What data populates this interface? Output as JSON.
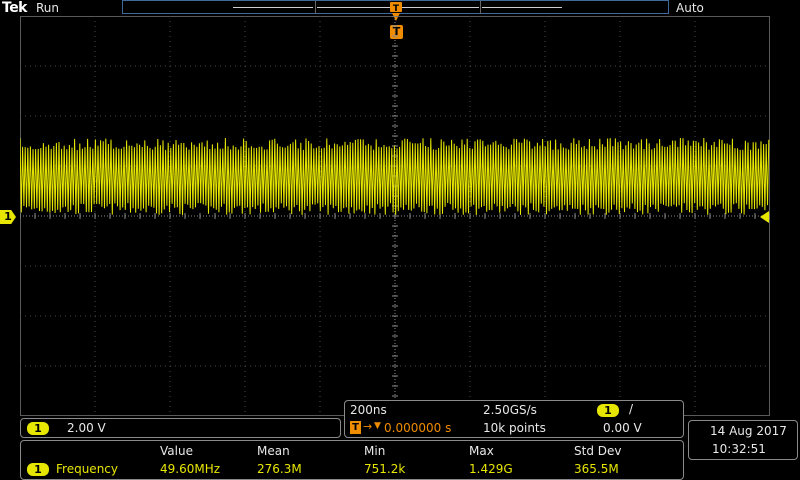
{
  "header": {
    "brand": "Tek",
    "acquisition_state": "Run",
    "trigger_mode": "Auto"
  },
  "trigger_marker_label": "T",
  "channel1": {
    "label": "1",
    "scale": "2.00 V"
  },
  "timebase": {
    "horizontal_scale": "200ns",
    "sample_rate": "2.50GS/s",
    "trigger_position_prefix": "T",
    "trigger_position": "0.000000 s",
    "record_length": "10k points",
    "trigger_source": "1",
    "trigger_slope": "/",
    "trigger_level": "0.00 V"
  },
  "measurements": {
    "headers": [
      "Value",
      "Mean",
      "Min",
      "Max",
      "Std Dev"
    ],
    "rows": [
      {
        "source": "1",
        "name": "Frequency",
        "value": "49.60MHz",
        "mean": "276.3M",
        "min": "751.2k",
        "max": "1.429G",
        "std_dev": "365.5M"
      }
    ]
  },
  "datetime": {
    "date": "14 Aug 2017",
    "time": "10:32:51"
  },
  "colors": {
    "channel1": "#e6e600",
    "trigger": "#f08c00",
    "record_frame": "#3f6a9a"
  }
}
